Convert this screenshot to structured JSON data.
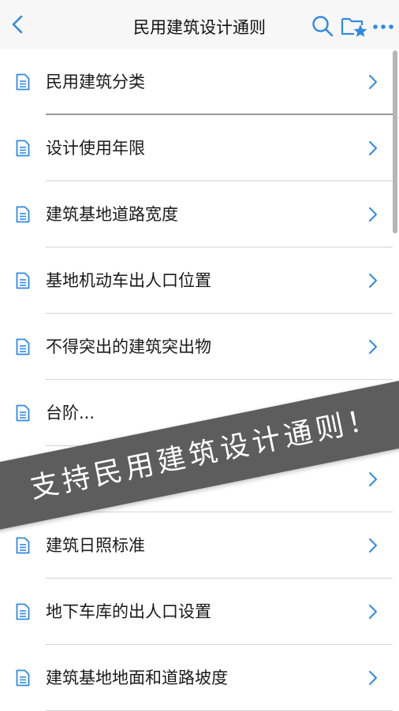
{
  "header": {
    "title": "民用建筑设计通则",
    "icons": {
      "back": "chevron-left-icon",
      "search": "search-icon",
      "favorite": "folder-star-icon",
      "more": "more-dots-icon"
    }
  },
  "colors": {
    "accent": "#2e8ae6",
    "banner": "#5d5d5d",
    "navbar": "#f7f7f7"
  },
  "list": {
    "items": [
      {
        "label": "民用建筑分类"
      },
      {
        "label": "设计使用年限"
      },
      {
        "label": "建筑基地道路宽度"
      },
      {
        "label": "基地机动车出人口位置"
      },
      {
        "label": "不得突出的建筑突出物"
      },
      {
        "label": "台阶..."
      },
      {
        "label": ""
      },
      {
        "label": "建筑日照标准"
      },
      {
        "label": "地下车库的出人口设置"
      },
      {
        "label": "建筑基地地面和道路坡度"
      }
    ]
  },
  "banner": {
    "text": "支持民用建筑设计通则！"
  }
}
